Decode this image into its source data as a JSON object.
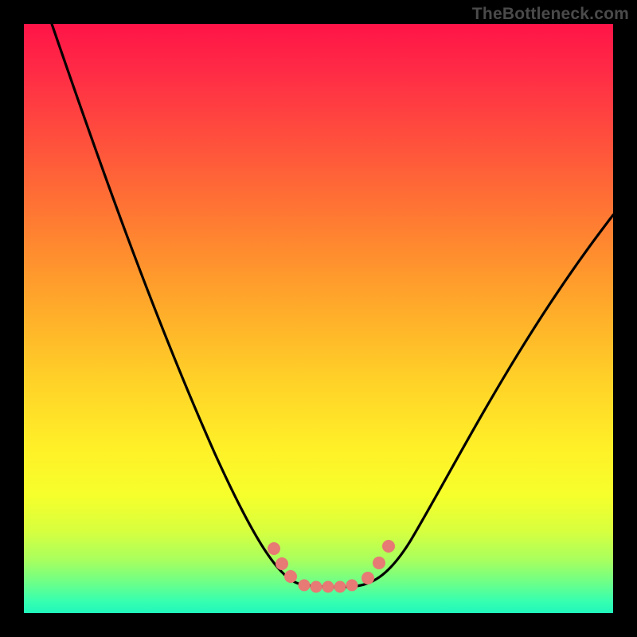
{
  "watermark": {
    "text": "TheBottleneck.com"
  },
  "chart_data": {
    "type": "line",
    "title": "",
    "xlabel": "",
    "ylabel": "",
    "xlim": [
      0,
      100
    ],
    "ylim": [
      0,
      100
    ],
    "grid": false,
    "note": "Background vertical gradient encodes value: red=high, green=low. Curve is a V-shaped bottleneck profile with a flat minimum near the center.",
    "series": [
      {
        "name": "bottleneck-curve",
        "x": [
          5,
          10,
          15,
          20,
          25,
          30,
          35,
          40,
          44,
          48,
          50,
          52,
          56,
          60,
          62,
          66,
          70,
          75,
          80,
          85,
          90,
          95,
          100
        ],
        "y": [
          100,
          88,
          76,
          64,
          52,
          41,
          30,
          20,
          12,
          6,
          5,
          5,
          5,
          6,
          8,
          13,
          20,
          29,
          38,
          46,
          54,
          61,
          68
        ]
      }
    ],
    "markers": [
      {
        "name": "left-cluster",
        "x": [
          44,
          46,
          48
        ],
        "y": [
          12,
          9,
          6
        ]
      },
      {
        "name": "flat-bottom",
        "x": [
          50,
          52,
          54,
          56,
          58
        ],
        "y": [
          5,
          5,
          5,
          5,
          5
        ]
      },
      {
        "name": "right-cluster",
        "x": [
          60,
          61.5,
          63
        ],
        "y": [
          7,
          9,
          12
        ]
      }
    ],
    "gradient_stops": [
      {
        "pos": 0.0,
        "color": "#ff1447"
      },
      {
        "pos": 0.5,
        "color": "#ffaa2a"
      },
      {
        "pos": 0.8,
        "color": "#f6ff2b"
      },
      {
        "pos": 1.0,
        "color": "#20f7bb"
      }
    ],
    "marker_color": "#e77a74",
    "curve_color": "#000000"
  }
}
